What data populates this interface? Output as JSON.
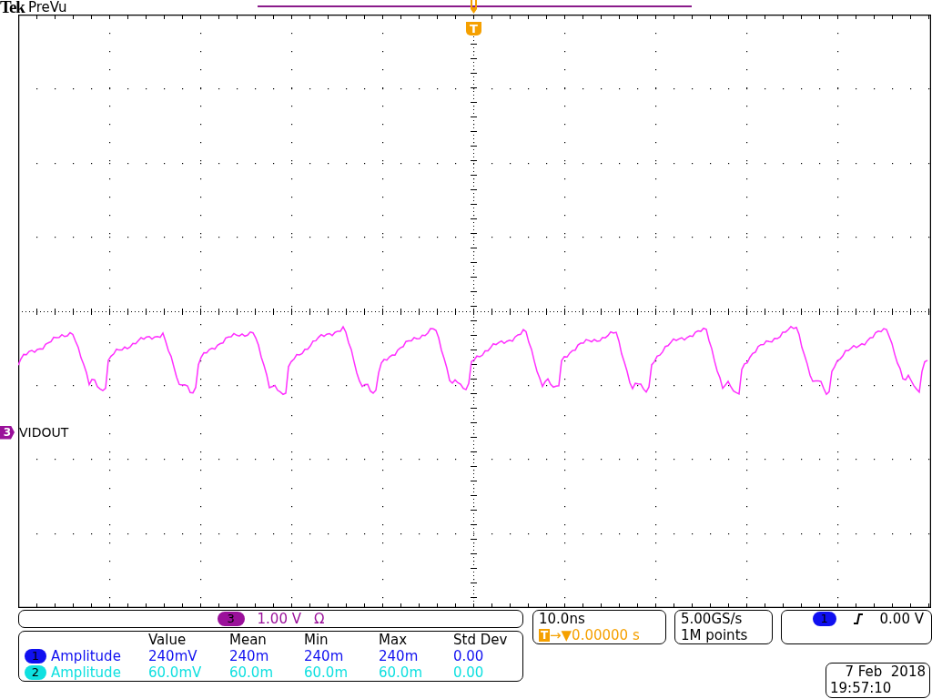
{
  "brand": "Tek",
  "mode": "PreVu",
  "trigger_marker": "T",
  "channel_marker": {
    "number": "3",
    "label": "VIDOUT"
  },
  "vertical": {
    "channel": "3",
    "scale": "1.00 V",
    "coupling": "Ω"
  },
  "measurements": {
    "columns": [
      "Value",
      "Mean",
      "Min",
      "Max",
      "Std Dev"
    ],
    "rows": [
      {
        "channel": "1",
        "name": "Amplitude",
        "color": "#1010f0",
        "cells": [
          "240mV",
          "240m",
          "240m",
          "240m",
          "0.00"
        ]
      },
      {
        "channel": "2",
        "name": "Amplitude",
        "color": "#10e0e0",
        "cells": [
          "60.0mV",
          "60.0m",
          "60.0m",
          "60.0m",
          "0.00"
        ]
      }
    ]
  },
  "horizontal": {
    "scale": "10.0ns",
    "delay_marker": "T",
    "delay_arrows": "→▼",
    "delay": "0.00000 s"
  },
  "acquisition": {
    "sample_rate": "5.00GS/s",
    "record_length": "1M points"
  },
  "trigger": {
    "source": "1",
    "level": "0.00 V"
  },
  "date": "7 Feb  2018",
  "time": "19:57:10"
}
